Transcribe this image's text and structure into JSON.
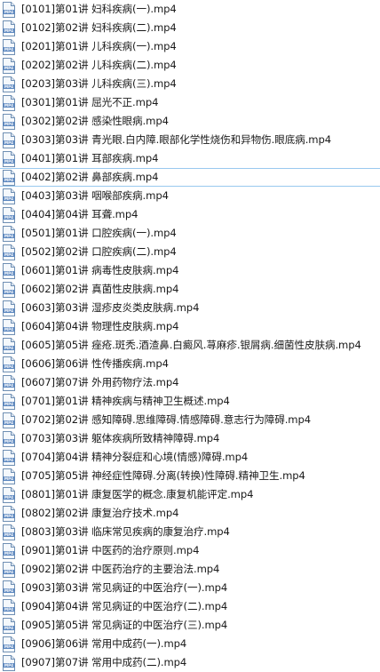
{
  "file_list": {
    "icon": "mp4-video-file-icon",
    "icon_label": "MP4",
    "colors": {
      "icon_stroke": "#6f8fb3",
      "icon_fill": "#f4f8fc",
      "icon_band": "#5a86bf",
      "selection_border": "#99c9ef"
    },
    "items": [
      {
        "name": "[0101]第01讲 妇科疾病(一).mp4"
      },
      {
        "name": "[0102]第02讲 妇科疾病(二).mp4"
      },
      {
        "name": "[0201]第01讲 儿科疾病(一).mp4"
      },
      {
        "name": "[0202]第02讲 儿科疾病(二).mp4"
      },
      {
        "name": "[0203]第03讲 儿科疾病(三).mp4"
      },
      {
        "name": "[0301]第01讲 屈光不正.mp4"
      },
      {
        "name": "[0302]第02讲 感染性眼病.mp4"
      },
      {
        "name": "[0303]第03讲 青光眼.白内障.眼部化学性烧伤和异物伤.眼底病.mp4"
      },
      {
        "name": "[0401]第01讲 耳部疾病.mp4"
      },
      {
        "name": "[0402]第02讲 鼻部疾病.mp4",
        "selected": true
      },
      {
        "name": "[0403]第03讲 咽喉部疾病.mp4"
      },
      {
        "name": "[0404]第04讲 耳聋.mp4"
      },
      {
        "name": "[0501]第01讲 口腔疾病(一).mp4"
      },
      {
        "name": "[0502]第02讲 口腔疾病(二).mp4"
      },
      {
        "name": "[0601]第01讲 病毒性皮肤病.mp4"
      },
      {
        "name": "[0602]第02讲 真菌性皮肤病.mp4"
      },
      {
        "name": "[0603]第03讲 湿疹皮炎类皮肤病.mp4"
      },
      {
        "name": "[0604]第04讲 物理性皮肤病.mp4"
      },
      {
        "name": "[0605]第05讲 痤疮.斑秃.酒渣鼻.白癜风.荨麻疹.银屑病.细菌性皮肤病.mp4"
      },
      {
        "name": "[0606]第06讲 性传播疾病.mp4"
      },
      {
        "name": "[0607]第07讲 外用药物疗法.mp4"
      },
      {
        "name": "[0701]第01讲 精神疾病与精神卫生概述.mp4"
      },
      {
        "name": "[0702]第02讲 感知障碍.思维障碍.情感障碍.意志行为障碍.mp4"
      },
      {
        "name": "[0703]第03讲 躯体疾病所致精神障碍.mp4"
      },
      {
        "name": "[0704]第04讲 精神分裂症和心境(情感)障碍.mp4"
      },
      {
        "name": "[0705]第05讲 神经症性障碍.分离(转换)性障碍.精神卫生.mp4"
      },
      {
        "name": "[0801]第01讲 康复医学的概念.康复机能评定.mp4"
      },
      {
        "name": "[0802]第02讲 康复治疗技术.mp4"
      },
      {
        "name": "[0803]第03讲 临床常见疾病的康复治疗.mp4"
      },
      {
        "name": "[0901]第01讲 中医药的治疗原则.mp4"
      },
      {
        "name": "[0902]第02讲 中医药治疗的主要治法.mp4"
      },
      {
        "name": "[0903]第03讲 常见病证的中医治疗(一).mp4"
      },
      {
        "name": "[0904]第04讲 常见病证的中医治疗(二).mp4"
      },
      {
        "name": "[0905]第05讲 常见病证的中医治疗(三).mp4"
      },
      {
        "name": "[0906]第06讲 常用中成药(一).mp4"
      },
      {
        "name": "[0907]第07讲 常用中成药(二).mp4"
      }
    ]
  }
}
